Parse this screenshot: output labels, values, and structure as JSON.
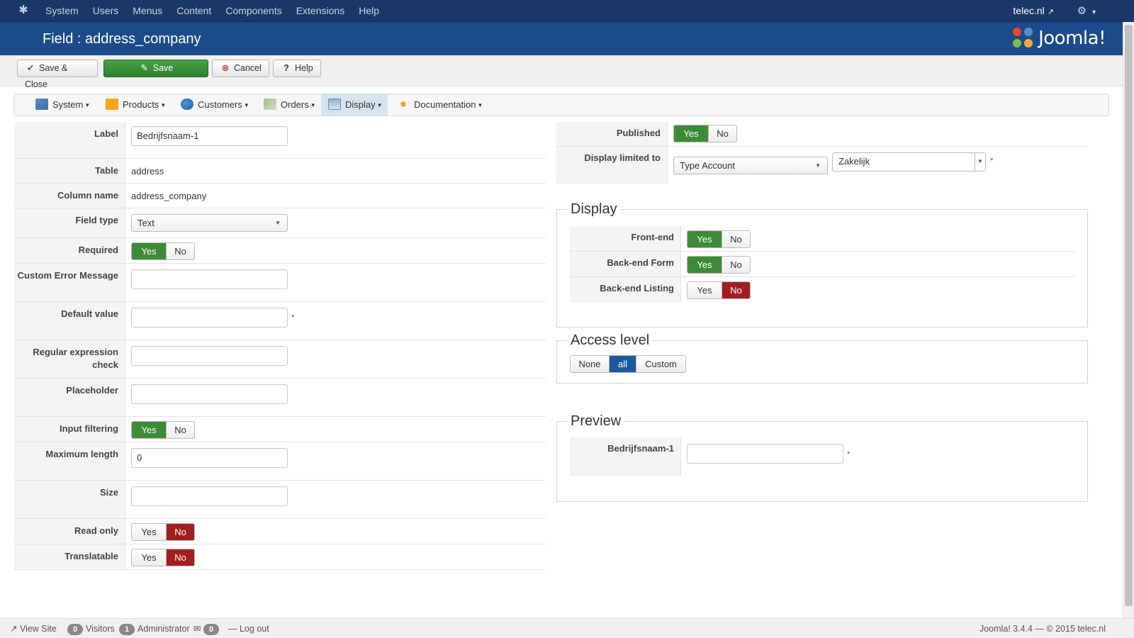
{
  "topnav": {
    "menu": [
      "System",
      "Users",
      "Menus",
      "Content",
      "Components",
      "Extensions",
      "Help"
    ],
    "site": "telec.nl"
  },
  "header": {
    "title": "Field : address_company",
    "brand": "Joomla!"
  },
  "toolbar": {
    "save_close": "Save & Close",
    "save": "Save",
    "cancel": "Cancel",
    "help": "Help"
  },
  "submenu": [
    "System",
    "Products",
    "Customers",
    "Orders",
    "Display",
    "Documentation"
  ],
  "form": {
    "label": {
      "label": "Label",
      "value": "Bedrijfsnaam-1"
    },
    "table": {
      "label": "Table",
      "value": "address"
    },
    "column_name": {
      "label": "Column name",
      "value": "address_company"
    },
    "field_type": {
      "label": "Field type",
      "value": "Text"
    },
    "required": {
      "label": "Required"
    },
    "custom_error": {
      "label": "Custom Error Message",
      "value": ""
    },
    "default_value": {
      "label": "Default value",
      "value": ""
    },
    "regex": {
      "label": "Regular expression check",
      "value": ""
    },
    "placeholder": {
      "label": "Placeholder",
      "value": ""
    },
    "input_filtering": {
      "label": "Input filtering"
    },
    "max_length": {
      "label": "Maximum length",
      "value": "0"
    },
    "size": {
      "label": "Size",
      "value": ""
    },
    "read_only": {
      "label": "Read only"
    },
    "translatable": {
      "label": "Translatable"
    }
  },
  "toggle": {
    "yes": "Yes",
    "no": "No"
  },
  "right": {
    "published": {
      "label": "Published"
    },
    "display_limited": {
      "label": "Display limited to",
      "select1": "Type Account",
      "select2": "Zakelijk"
    },
    "display": {
      "legend": "Display",
      "frontend": "Front-end",
      "backend_form": "Back-end Form",
      "backend_listing": "Back-end Listing"
    },
    "access": {
      "legend": "Access level",
      "none": "None",
      "all": "all",
      "custom": "Custom"
    },
    "preview": {
      "legend": "Preview",
      "label": "Bedrijfsnaam-1",
      "value": ""
    }
  },
  "footer": {
    "view_site": "View Site",
    "visitors_count": "0",
    "visitors": "Visitors",
    "admin_count": "1",
    "administrator": "Administrator",
    "mail_count": "0",
    "logout": "Log out",
    "version": "Joomla! 3.4.4 — © 2015 telec.nl"
  },
  "colors": {
    "navy": "#1a3867",
    "header": "#1b4b8a",
    "green": "#3d8b37",
    "red": "#a11e1e",
    "blue": "#1b5a9a"
  }
}
